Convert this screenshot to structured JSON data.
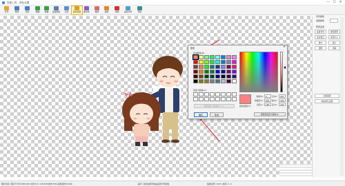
{
  "window": {
    "title": "抠图工具 - 颜色设置",
    "controls": {
      "minimize": "—",
      "maximize": "☐",
      "close": "✕"
    }
  },
  "toolbar": {
    "items": [
      {
        "label": "打开",
        "icon": "folder-open-icon",
        "color": "#e0a82e"
      },
      {
        "label": "保存",
        "icon": "save-icon",
        "color": "#4a7fc1"
      },
      {
        "label": "另存",
        "icon": "save-as-icon",
        "color": "#4a7fc1"
      },
      {
        "label": "撤销",
        "icon": "undo-icon",
        "color": "#3b9c4c"
      },
      {
        "label": "重做",
        "icon": "redo-icon",
        "color": "#3b9c4c"
      },
      {
        "label": "设置图层",
        "icon": "layer-icon",
        "color": "#5a7fb0"
      },
      {
        "label": "高清",
        "icon": "hd-icon",
        "color": "#5a8fd0"
      },
      {
        "label": "自动识别",
        "icon": "auto-detect-icon",
        "color": "#d9a221"
      },
      {
        "label": "魔术棒",
        "icon": "magic-wand-icon",
        "color": "#8a5bc0"
      },
      {
        "label": "橡皮",
        "icon": "eraser-icon",
        "color": "#d96b6b"
      },
      {
        "label": "画笔",
        "icon": "brush-icon",
        "color": "#d98b2b"
      },
      {
        "label": "清除",
        "icon": "clear-icon",
        "color": "#d03030"
      },
      {
        "label": "设置背景",
        "icon": "background-icon",
        "color": "#4a9fd0"
      },
      {
        "label": "预览",
        "icon": "preview-icon",
        "color": "#3a8f8f"
      }
    ],
    "active_index": 7
  },
  "right_panel": {
    "bg_color_label": "背景颜色",
    "bg_color_field": "选取颜色",
    "output_label": "预览设置",
    "buttons": [
      "设置背景",
      "保存结果",
      "适合窗口",
      "实际大小",
      "放大",
      "缩小",
      "透明",
      "清除"
    ],
    "wide_buttons": [
      "高级选项",
      "恢复默认设置"
    ]
  },
  "color_dialog": {
    "title": "颜色",
    "close": "✕",
    "basic_colors_label": "基本颜色(B):",
    "custom_colors_label": "自定义颜色(C):",
    "define_custom_label": "规定自定义颜色(D) >>",
    "ok_label": "确定",
    "cancel_label": "取消",
    "preview_label": "颜色|纯色(O)",
    "add_custom_label": "添加到自定义颜色(A)",
    "basic_colors": [
      "#ff8080",
      "#ffff80",
      "#80ff80",
      "#00ff80",
      "#80ffff",
      "#0080ff",
      "#ff80c0",
      "#ff80ff",
      "#ff0000",
      "#ffff00",
      "#80ff00",
      "#00ff40",
      "#00ffff",
      "#0080c0",
      "#8080c0",
      "#ff00ff",
      "#804040",
      "#ff8040",
      "#00ff00",
      "#008080",
      "#004080",
      "#8080ff",
      "#800040",
      "#ff0080",
      "#800000",
      "#ff8000",
      "#008000",
      "#008040",
      "#0000ff",
      "#0000a0",
      "#800080",
      "#8000ff",
      "#400000",
      "#804000",
      "#004000",
      "#004040",
      "#000080",
      "#000040",
      "#400040",
      "#400080",
      "#000000",
      "#808000",
      "#808040",
      "#808080",
      "#408080",
      "#c0c0c0",
      "#400040",
      "#ffffff"
    ],
    "selected_index": 0,
    "custom_colors_count": 16,
    "fields": {
      "hue_label": "色调(E):",
      "hue": "0",
      "sat_label": "饱和度(S):",
      "sat": "240",
      "lum_label": "亮度(L):",
      "lum": "180",
      "red_label": "红(R):",
      "red": "255",
      "green_label": "绿(G):",
      "green": "128",
      "blue_label": "蓝(U):",
      "blue": "128"
    },
    "current_color": "#ff8080"
  },
  "status_bar": {
    "left": "图片信息: 图片尺寸为:800x600 文件大小:128.5KB 格式:PNG 颜色模式:RGBA",
    "middle": "提示: 鼠标右键可快速设置背景颜色",
    "right": "缩放比例: 100% 坐标: 0, 0"
  },
  "annotation": {
    "color": "#d9363e"
  }
}
